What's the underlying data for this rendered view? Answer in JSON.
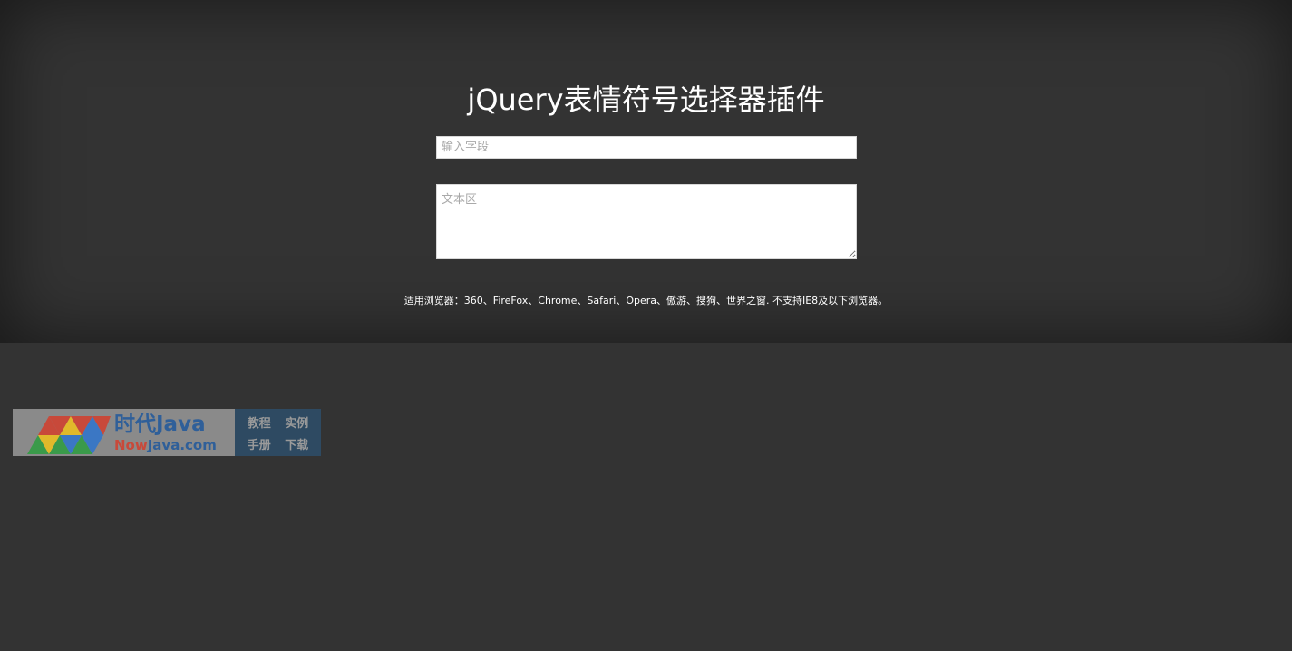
{
  "hero": {
    "title": "jQuery表情符号选择器插件"
  },
  "form": {
    "input_placeholder": "输入字段",
    "input_value": "",
    "textarea_placeholder": "文本区",
    "textarea_value": ""
  },
  "browser_note": "适用浏览器：360、FireFox、Chrome、Safari、Opera、傲游、搜狗、世界之窗. 不支持IE8及以下浏览器。",
  "watermark": {
    "name": "时代Java",
    "domain_prefix": "Now",
    "domain_suffix": "Java.com",
    "links": [
      "教程",
      "实例",
      "手册",
      "下载"
    ]
  },
  "colors": {
    "background": "#333333",
    "watermark_brand": "#2f5f99",
    "watermark_accent": "#c8493a"
  }
}
